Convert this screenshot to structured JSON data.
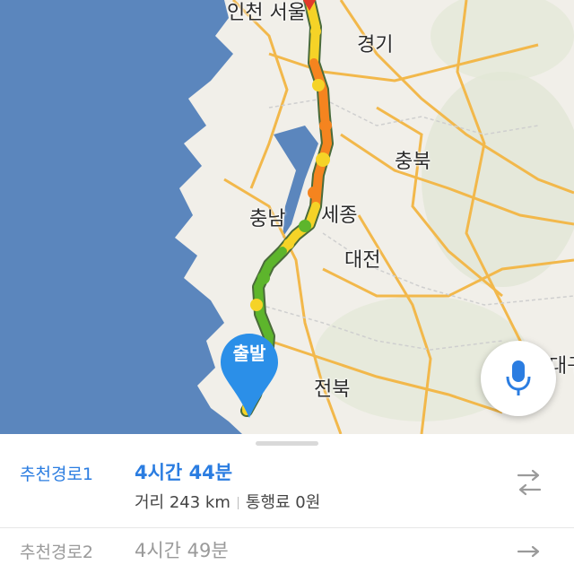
{
  "map": {
    "regions": {
      "incheon_seoul": "인천 서울",
      "gyeonggi": "경기",
      "chungbuk": "충북",
      "chungnam": "충남",
      "sejong": "세종",
      "daejeon": "대전",
      "jeonbuk": "전북",
      "gangwon_partial": "대구"
    },
    "start_pin_label": "출발",
    "colors": {
      "sea": "#5b86bd",
      "land": "#f1efe9",
      "road": "#f2b84b",
      "traffic_green": "#5db52c",
      "traffic_yellow": "#f5d327",
      "traffic_orange": "#f5841f",
      "traffic_red": "#e23a2a",
      "pin": "#2b8fe8"
    }
  },
  "mic_button": {
    "icon": "microphone-icon",
    "color": "#2b7de1"
  },
  "routes": [
    {
      "name": "추천경로1",
      "time": "4시간 44분",
      "distance": "거리 243 km",
      "toll": "통행료 0원",
      "selected": true
    },
    {
      "name": "추천경로2",
      "time": "4시간 49분",
      "selected": false
    }
  ]
}
